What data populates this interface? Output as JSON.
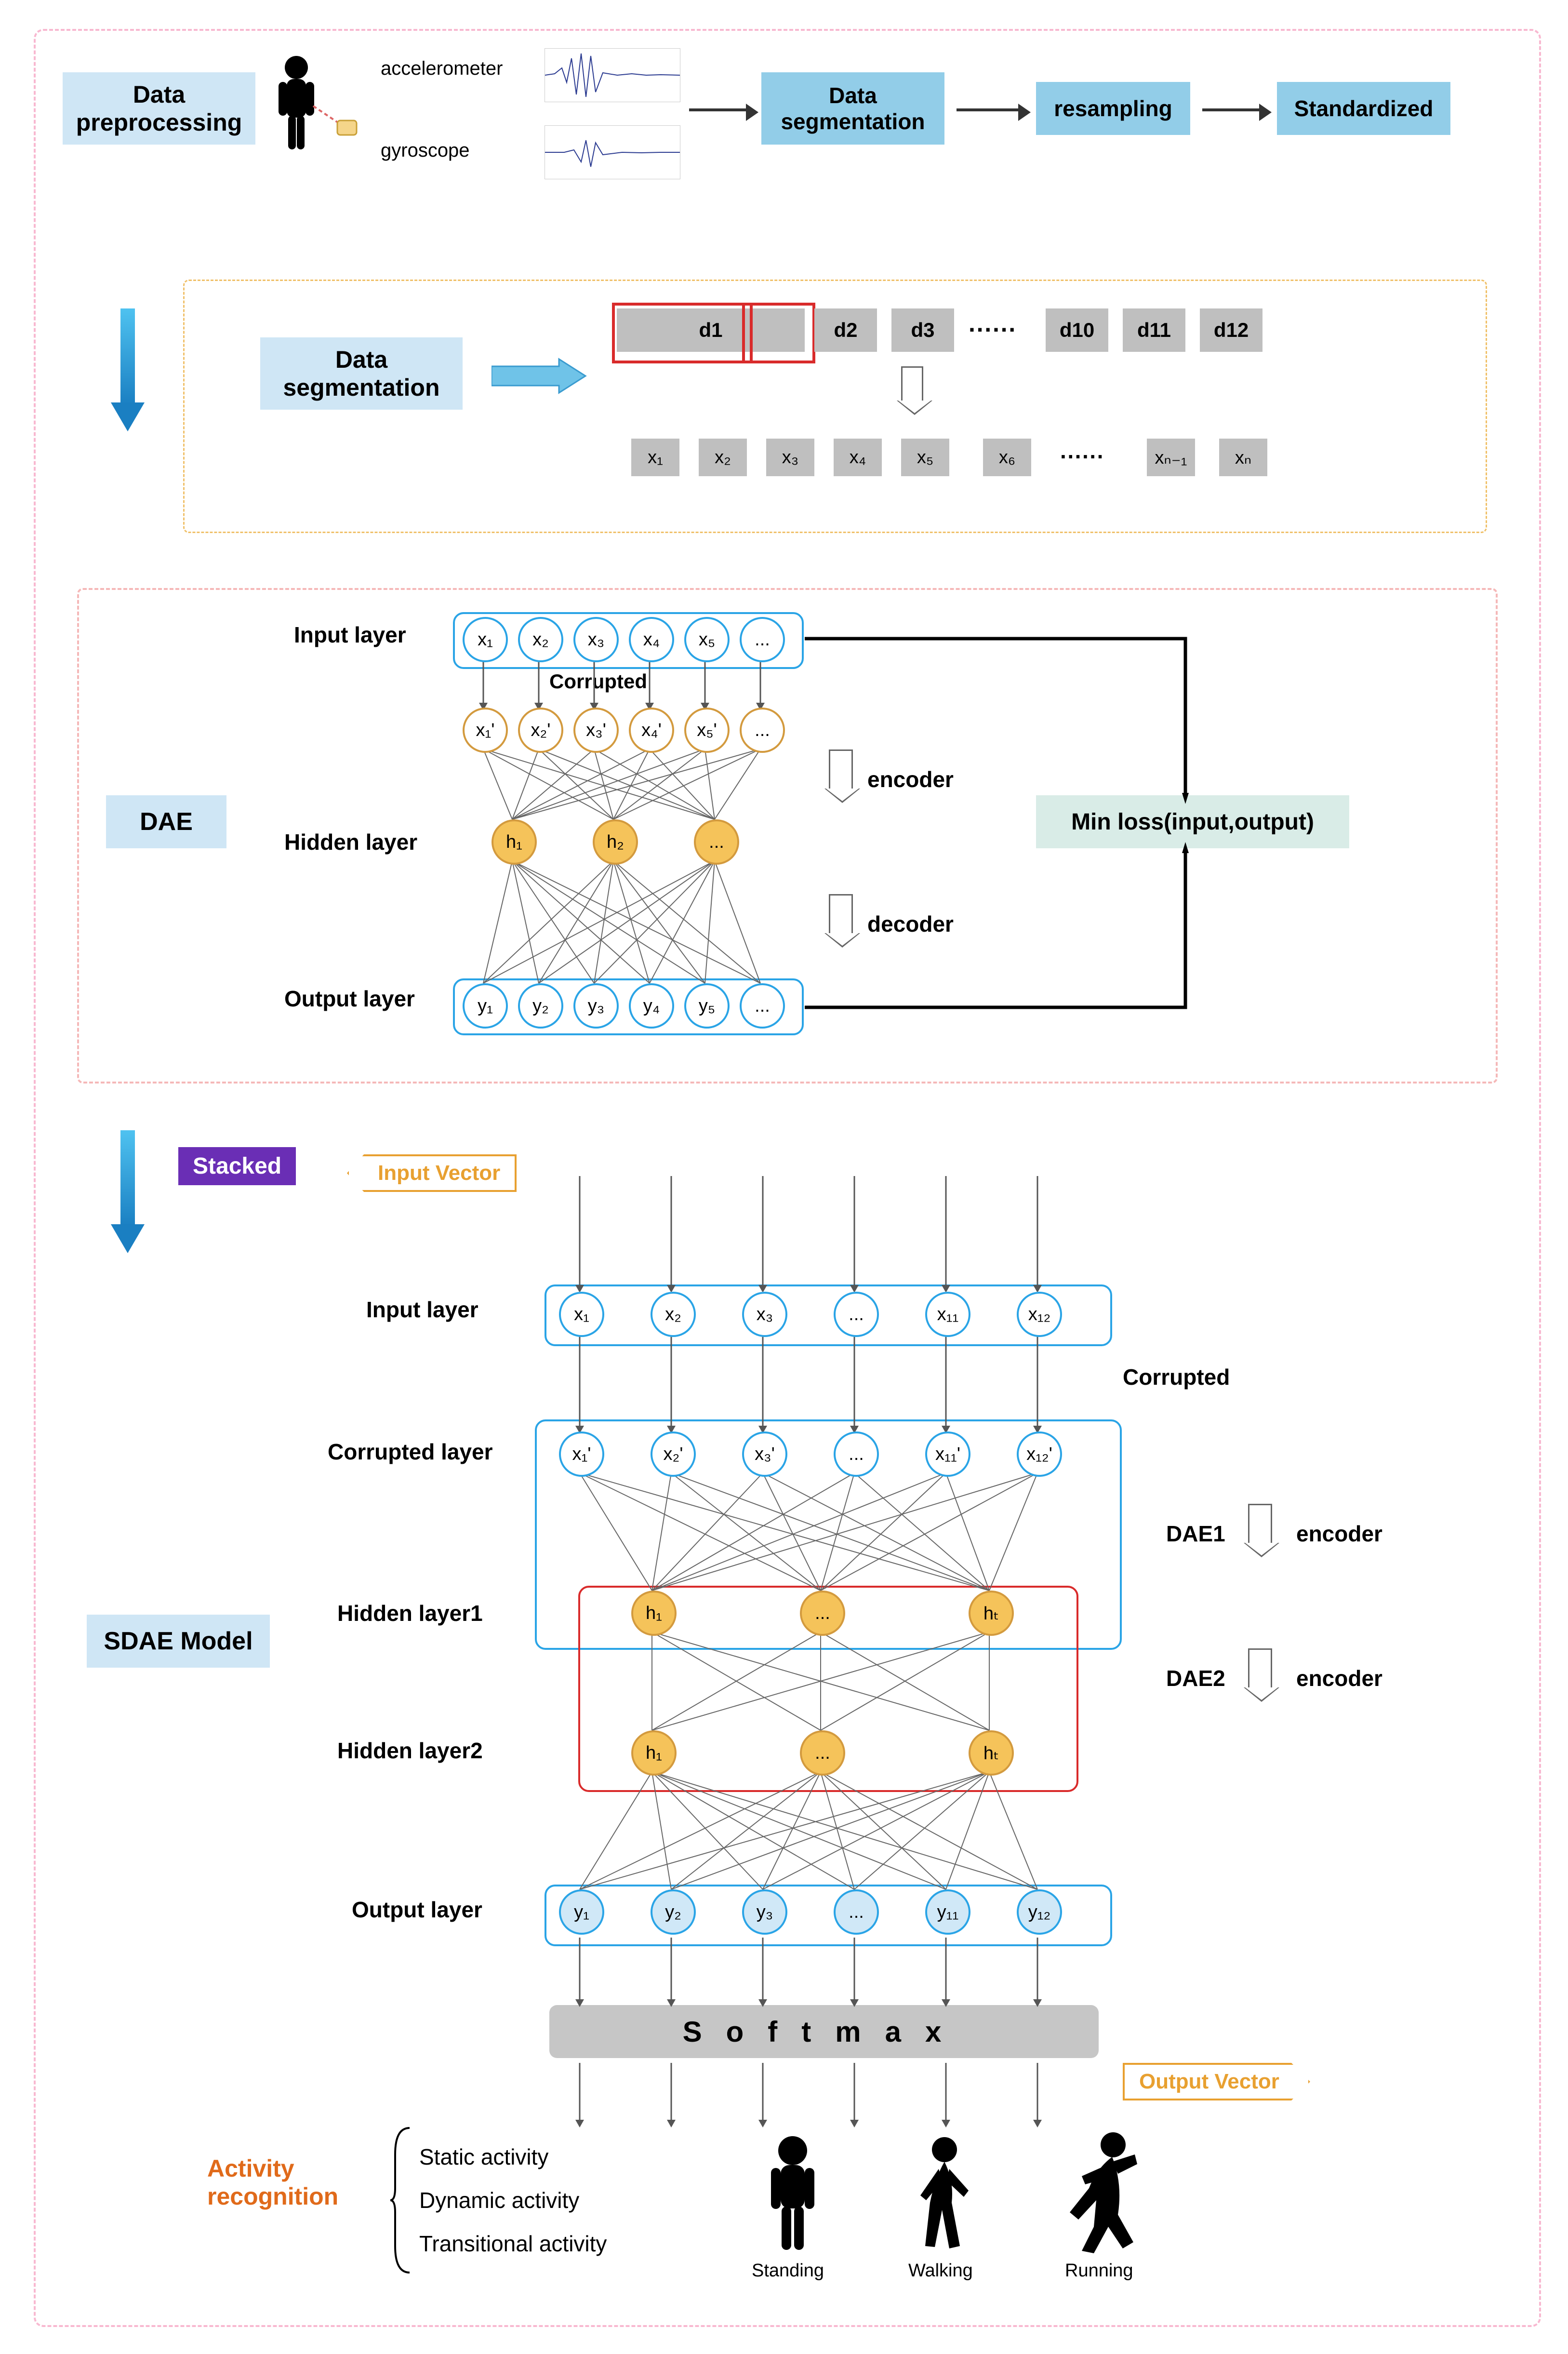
{
  "preproc": {
    "title": "Data\npreprocessing",
    "sensor1": "accelerometer",
    "sensor2": "gyroscope",
    "seg": "Data\nsegmentation",
    "resamp": "resampling",
    "std": "Standardized"
  },
  "dseg": {
    "title": "Data\nsegmentation",
    "d": [
      "d1",
      "d2",
      "d3",
      "d10",
      "d11",
      "d12"
    ],
    "dots": "······",
    "x": [
      "x₁",
      "x₂",
      "x₃",
      "x₄",
      "x₅",
      "x₆",
      "xₙ₋₁",
      "xₙ"
    ],
    "xdots": "······"
  },
  "dae": {
    "title": "DAE",
    "input": "Input layer",
    "hidden": "Hidden layer",
    "output": "Output layer",
    "corrupted": "Corrupted",
    "encoder": "encoder",
    "decoder": "decoder",
    "loss": "Min loss(input,output)",
    "xi": [
      "x₁",
      "x₂",
      "x₃",
      "x₄",
      "x₅",
      "..."
    ],
    "xc": [
      "x₁'",
      "x₂'",
      "x₃'",
      "x₄'",
      "x₅'",
      "..."
    ],
    "h": [
      "h₁",
      "h₂",
      "..."
    ],
    "y": [
      "y₁",
      "y₂",
      "y₃",
      "y₄",
      "y₅",
      "..."
    ]
  },
  "stacked": "Stacked",
  "inputVec": "Input Vector",
  "outputVec": "Output Vector",
  "sdae": {
    "title": "SDAE Model",
    "layers": {
      "input": "Input layer",
      "corr": "Corrupted layer",
      "h1": "Hidden layer1",
      "h2": "Hidden layer2",
      "out": "Output layer"
    },
    "dae1": "DAE1",
    "dae2": "DAE2",
    "enc": "encoder",
    "corrupted": "Corrupted",
    "xi": [
      "x₁",
      "x₂",
      "x₃",
      "...",
      "x₁₁",
      "x₁₂"
    ],
    "xc": [
      "x₁'",
      "x₂'",
      "x₃'",
      "...",
      "x₁₁'",
      "x₁₂'"
    ],
    "h": [
      "h₁",
      "...",
      "hₜ"
    ],
    "y": [
      "y₁",
      "y₂",
      "y₃",
      "...",
      "y₁₁",
      "y₁₂"
    ],
    "softmax": "Softmax"
  },
  "activity": {
    "title": "Activity\nrecognition",
    "types": [
      "Static activity",
      "Dynamic activity",
      "Transitional activity"
    ],
    "poses": [
      "Standing",
      "Walking",
      "Running"
    ]
  }
}
